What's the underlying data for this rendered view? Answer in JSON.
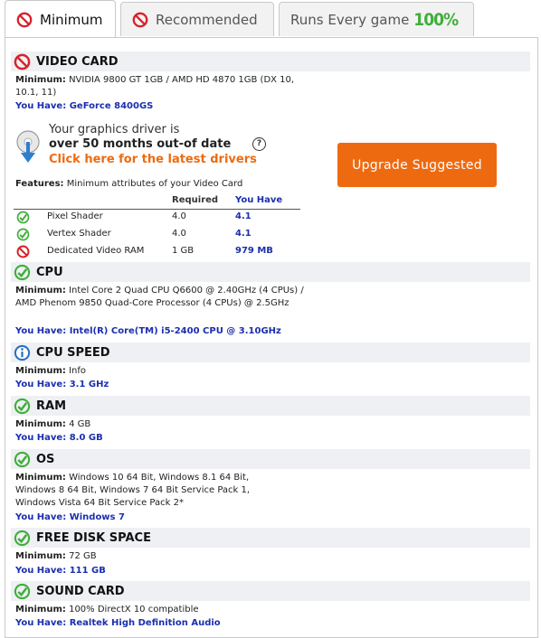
{
  "tabs": [
    {
      "label": "Minimum",
      "icon": "no-icon"
    },
    {
      "label": "Recommended",
      "icon": "no-icon"
    },
    {
      "label": "Runs Every game",
      "badge": "100%"
    }
  ],
  "common": {
    "minimum_label": "Minimum:",
    "you_have_label": "You Have:"
  },
  "sections": {
    "video": {
      "title": "VIDEO CARD",
      "status": "fail",
      "minimum": "NVIDIA 9800 GT 1GB / AMD HD 4870 1GB (DX 10, 10.1, 11)",
      "you_have": "GeForce 8400GS"
    },
    "cpu": {
      "title": "CPU",
      "status": "pass",
      "minimum": "Intel Core 2 Quad CPU Q6600 @ 2.40GHz (4 CPUs) / AMD Phenom 9850 Quad-Core Processor (4 CPUs) @ 2.5GHz",
      "you_have": "Intel(R) Core(TM) i5-2400 CPU @ 3.10GHz"
    },
    "cpu_speed": {
      "title": "CPU SPEED",
      "status": "info",
      "minimum": "Info",
      "you_have": "3.1 GHz"
    },
    "ram": {
      "title": "RAM",
      "status": "pass",
      "minimum": "4 GB",
      "you_have": "8.0 GB"
    },
    "os": {
      "title": "OS",
      "status": "pass",
      "minimum": "Windows 10 64 Bit, Windows 8.1 64 Bit, Windows 8 64 Bit, Windows 7 64 Bit Service Pack 1, Windows Vista 64 Bit Service Pack 2*",
      "you_have": "Windows 7"
    },
    "disk": {
      "title": "FREE DISK SPACE",
      "status": "pass",
      "minimum": "72 GB",
      "you_have": "111 GB"
    },
    "sound": {
      "title": "SOUND CARD",
      "status": "pass",
      "minimum": "100% DirectX 10 compatible",
      "you_have": "Realtek High Definition Audio"
    }
  },
  "driver_notice": {
    "line1": "Your graphics driver is",
    "line2": "over 50 months out-of date",
    "link": "Click here for the latest drivers"
  },
  "upgrade_button": "Upgrade Suggested",
  "features": {
    "label": "Features:",
    "description": "Minimum attributes of your Video Card",
    "col_required": "Required",
    "col_you_have": "You Have",
    "rows": [
      {
        "name": "Pixel Shader",
        "required": "4.0",
        "you_have": "4.1",
        "status": "pass"
      },
      {
        "name": "Vertex Shader",
        "required": "4.0",
        "you_have": "4.1",
        "status": "pass"
      },
      {
        "name": "Dedicated Video RAM",
        "required": "1 GB",
        "you_have": "979 MB",
        "status": "fail"
      }
    ]
  },
  "colors": {
    "fail": "#d9212b",
    "pass": "#3fae3a",
    "info": "#2a72c4",
    "accent": "#ee6a10",
    "have_text": "#1a2fb0"
  }
}
